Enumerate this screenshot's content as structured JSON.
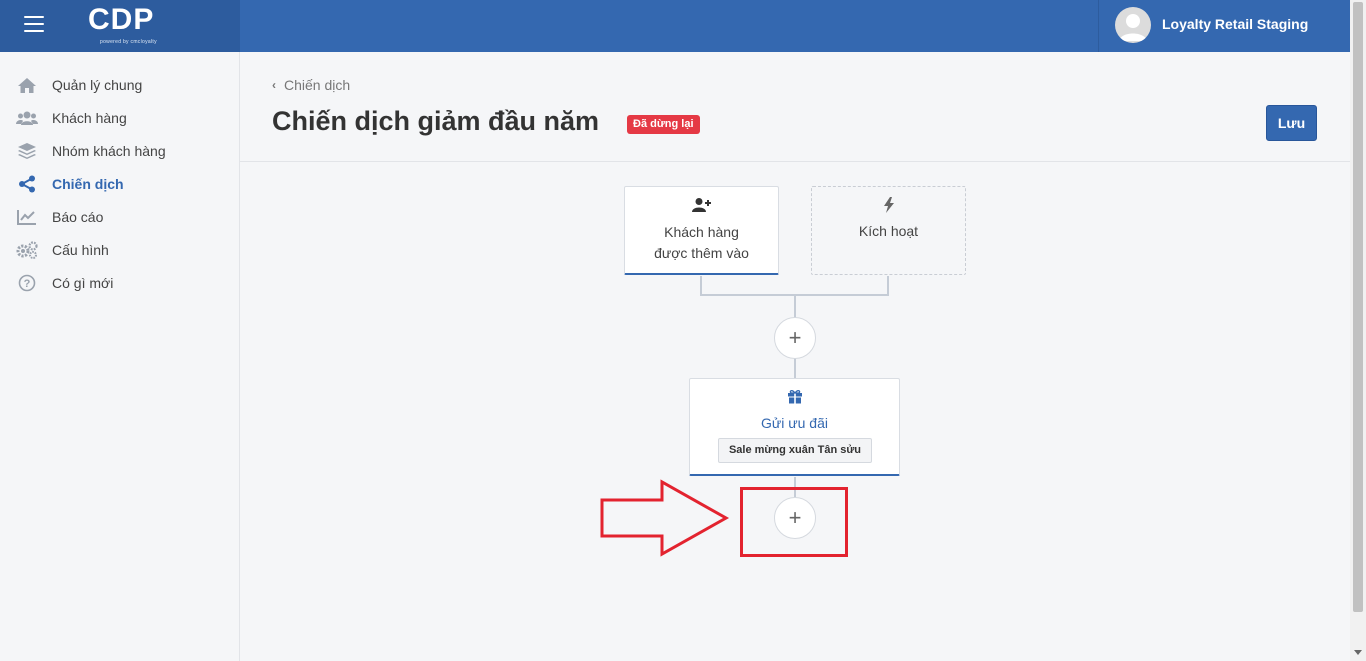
{
  "header": {
    "logo": "CDP",
    "logo_sub": "powered by cmcloyalty",
    "user_name": "Loyalty Retail Staging"
  },
  "sidebar": {
    "items": [
      {
        "label": "Quản lý chung",
        "icon": "home-icon"
      },
      {
        "label": "Khách hàng",
        "icon": "users-icon"
      },
      {
        "label": "Nhóm khách hàng",
        "icon": "layers-icon"
      },
      {
        "label": "Chiến dịch",
        "icon": "share-icon",
        "active": true
      },
      {
        "label": "Báo cáo",
        "icon": "chart-line-icon"
      },
      {
        "label": "Cấu hình",
        "icon": "gears-icon"
      },
      {
        "label": "Có gì mới",
        "icon": "question-circle-icon"
      }
    ]
  },
  "page": {
    "breadcrumb": "Chiến dịch",
    "title": "Chiến dịch giảm đầu năm",
    "status": "Đã dừng lại",
    "save_label": "Lưu"
  },
  "flow": {
    "trigger1_line1": "Khách hàng",
    "trigger1_line2": "được thêm vào",
    "trigger2": "Kích hoạt",
    "add_symbol": "+",
    "action_label": "Gửi ưu đãi",
    "action_chip": "Sale mừng xuân Tân sửu"
  },
  "colors": {
    "primary": "#3468b0",
    "badge": "#e53945",
    "annotation": "#e3232f"
  }
}
